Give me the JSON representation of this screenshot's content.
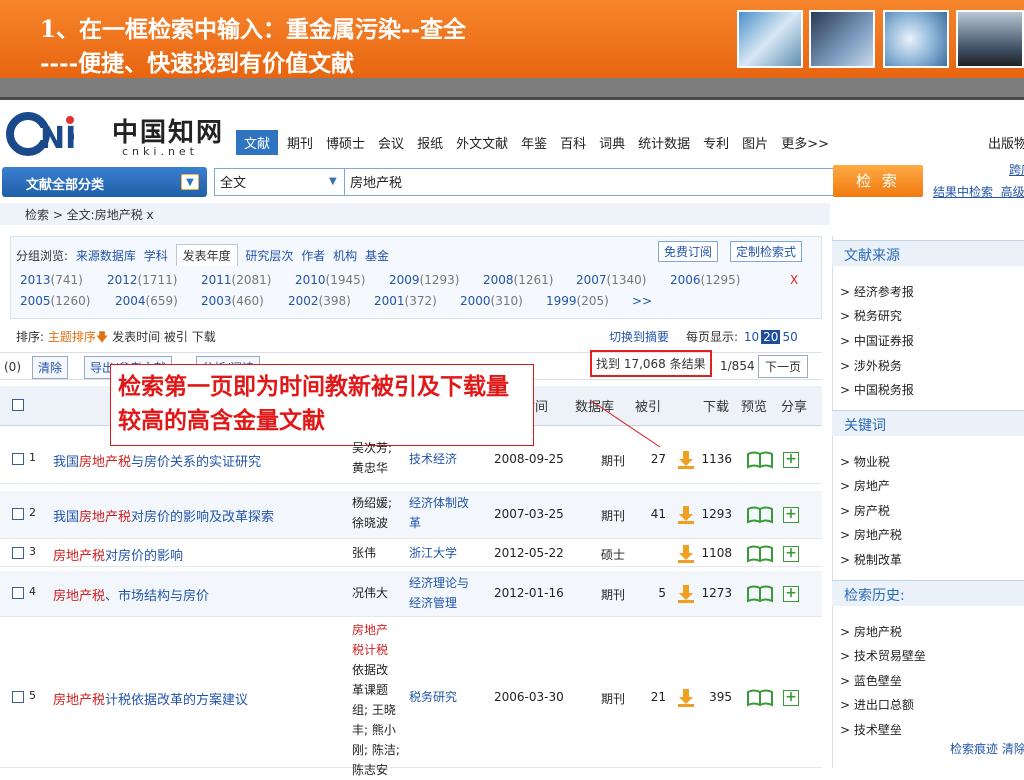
{
  "banner": {
    "line1": "1、在一框检索中输入：重金属污染--查全",
    "line2": "----便捷、快速找到有价值文献"
  },
  "logo": {
    "cn": "中国知网",
    "url": "cnki.net"
  },
  "nav": [
    "文献",
    "期刊",
    "博硕士",
    "会议",
    "报纸",
    "外文文献",
    "年鉴",
    "百科",
    "词典",
    "统计数据",
    "专利",
    "图片",
    "更多>>"
  ],
  "publisher": "出版物",
  "search": {
    "category": "文献全部分类",
    "field": "全文",
    "query": "房地产税",
    "button": "检 索",
    "in_results": "结果中检索",
    "cross": "跨库",
    "advanced": "高级"
  },
  "crumb": "检索 > 全文:房地产税  x",
  "grouping": {
    "label": "分组浏览:",
    "items": [
      "来源数据库",
      "学科",
      "发表年度",
      "研究层次",
      "作者",
      "机构",
      "基金"
    ],
    "active": "发表年度",
    "free_sub": "免费订阅",
    "custom": "定制检索式"
  },
  "years": [
    {
      "y": "2013",
      "c": "(741)"
    },
    {
      "y": "2012",
      "c": "(1711)"
    },
    {
      "y": "2011",
      "c": "(2081)"
    },
    {
      "y": "2010",
      "c": "(1945)"
    },
    {
      "y": "2009",
      "c": "(1293)"
    },
    {
      "y": "2008",
      "c": "(1261)"
    },
    {
      "y": "2007",
      "c": "(1340)"
    },
    {
      "y": "2006",
      "c": "(1295)"
    },
    {
      "y": "2005",
      "c": "(1260)"
    },
    {
      "y": "2004",
      "c": "(659)"
    },
    {
      "y": "2003",
      "c": "(460)"
    },
    {
      "y": "2002",
      "c": "(398)"
    },
    {
      "y": "2001",
      "c": "(372)"
    },
    {
      "y": "2000",
      "c": "(310)"
    },
    {
      "y": "1999",
      "c": "(205)"
    },
    {
      "y": ">>",
      "c": ""
    }
  ],
  "years_close": "X",
  "sort": {
    "label": "排序:",
    "items": [
      "主题排序",
      "发表时间",
      "被引",
      "下载"
    ]
  },
  "switch_abstract": "切换到摘要",
  "per_page": {
    "label": "每页显示:",
    "options": [
      "10",
      "20",
      "50"
    ],
    "selected": "20"
  },
  "toolbar": {
    "count": "(0)",
    "clear": "清除",
    "export": "导出/参考文献",
    "analyze": "分析/阅读"
  },
  "results": {
    "found": "找到 17,068 条结果",
    "page": "1/854",
    "next": "下一页"
  },
  "headers": {
    "time": "时间",
    "db": "数据库",
    "cite": "被引",
    "download": "下载",
    "preview": "预览",
    "share": "分享"
  },
  "rows": [
    {
      "num": "1",
      "title_pre": "我国",
      "title_hl": "房地产税",
      "title_post": "与房价关系的实证研究",
      "author_lines": [
        "吴次芳;",
        "黄忠华"
      ],
      "source_lines": [
        "技术经济"
      ],
      "date": "2008-09-25",
      "db": "期刊",
      "cite": "27",
      "downloads": "1136"
    },
    {
      "num": "2",
      "title_pre": "我国",
      "title_hl": "房地产税",
      "title_post": "对房价的影响及改革探索",
      "author_lines": [
        "杨绍媛;",
        "徐晓波"
      ],
      "source_lines": [
        "经济体制改",
        "革"
      ],
      "date": "2007-03-25",
      "db": "期刊",
      "cite": "41",
      "downloads": "1293"
    },
    {
      "num": "3",
      "title_pre": "",
      "title_hl": "房地产税",
      "title_post": "对房价的影响",
      "author_lines": [
        "张伟"
      ],
      "source_lines": [
        "浙江大学"
      ],
      "date": "2012-05-22",
      "db": "硕士",
      "cite": "",
      "downloads": "1108"
    },
    {
      "num": "4",
      "title_pre": "",
      "title_hl": "房地产税",
      "title_post": "、市场结构与房价",
      "author_lines": [
        "况伟大"
      ],
      "source_lines": [
        "经济理论与",
        "经济管理"
      ],
      "date": "2012-01-16",
      "db": "期刊",
      "cite": "5",
      "downloads": "1273"
    },
    {
      "num": "5",
      "title_pre": "",
      "title_hl": "房地产税",
      "title_post": "计税依据改革的方案建议",
      "author_lines": [
        "房地产",
        "税计税",
        "依据改",
        "革课题",
        "组; 王晓",
        "丰; 熊小",
        "刚; 陈洁;",
        "陈志安"
      ],
      "source_lines": [
        "税务研究"
      ],
      "date": "2006-03-30",
      "db": "期刊",
      "cite": "21",
      "downloads": "395"
    }
  ],
  "sidebar": {
    "source_head": "文献来源",
    "sources": [
      "> 经济参考报",
      "> 税务研究",
      "> 中国证券报",
      "> 涉外税务",
      "> 中国税务报"
    ],
    "keyword_head": "关键词",
    "keywords": [
      "> 物业税",
      "> 房地产",
      "> 房产税",
      "> 房地产税",
      "> 税制改革"
    ],
    "history_head": "检索历史:",
    "history": [
      "> 房地产税",
      "> 技术贸易壁垒",
      "> 蓝色壁垒",
      "> 进出口总额",
      "> 技术壁垒"
    ],
    "trace": "检索痕迹   清除"
  },
  "annotation": "检索第一页即为时间教新被引及下载量较高的高含金量文献",
  "colors": {
    "banner": "#e86510",
    "accent": "#2f74c0",
    "highlight": "#d02020",
    "annotation": "#e01818"
  }
}
